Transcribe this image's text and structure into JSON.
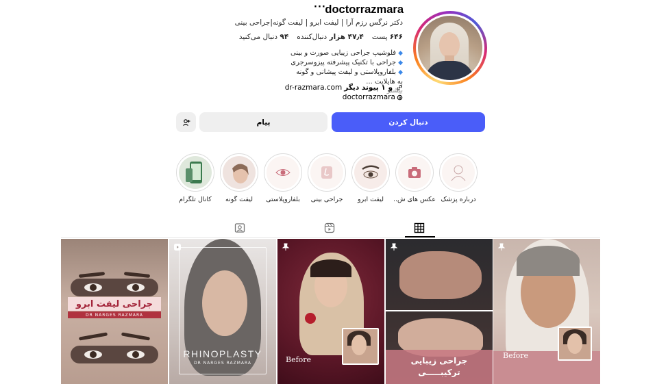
{
  "profile": {
    "username": "doctorrazmara",
    "more": "···",
    "full_name": "دکتر نرگس رزم آرا | لیفت ابرو | لیفت گونه|جراحی بینی",
    "stats": {
      "posts_count": "۶۴۶",
      "posts_label": "پست",
      "followers_count": "۴۷٫۴ هزار",
      "followers_label": "دنبال‌کننده",
      "following_count": "۹۴",
      "following_label": "دنبال می‌کنید"
    },
    "bio": [
      "فلوشیپ جراحی زیبایی صورت و بینی",
      "جراحی با تکنیک پیشرفته پیزوسرجری",
      "بلفاروپلاستی و لیفت پیشانی و گونه",
      "به هایلایت ...",
      "بیشتر"
    ],
    "link_text": "dr-razmara.com",
    "link_others": "و ۱ پیوند دیگر",
    "threads_handle": "doctorrazmara"
  },
  "buttons": {
    "follow": "دنبال کردن",
    "message": "پیام"
  },
  "highlights": [
    {
      "label": "درباره پزشک"
    },
    {
      "label": "عکس های ش..."
    },
    {
      "label": "لیفت ابرو"
    },
    {
      "label": "جراحی بینی"
    },
    {
      "label": "بلفاروپلاستی"
    },
    {
      "label": "لیفت گونه"
    },
    {
      "label": "کانال تلگرام"
    }
  ],
  "posts": {
    "p1": {
      "banner": "جراحی لیفت ابرو",
      "sub": "DR NARGES RAZMARA"
    },
    "p2": {
      "title": "RHINOPLASTY",
      "sub": "DR NARGES RAZMARA"
    },
    "p3": {
      "before": "Before"
    },
    "p4": {
      "caption_1": "جراحی زیبایی",
      "caption_2": "ترکیبـــــی"
    },
    "p5": {
      "before": "Before"
    }
  },
  "colors": {
    "follow_bg": "#4a5df9",
    "button_bg": "#efefef",
    "link_blue": "#3a87e8"
  },
  "icons": [
    "more-icon",
    "link-icon",
    "threads-icon",
    "add-person-icon",
    "grid-icon",
    "reels-icon",
    "tagged-icon",
    "pin-icon",
    "reel-icon"
  ]
}
